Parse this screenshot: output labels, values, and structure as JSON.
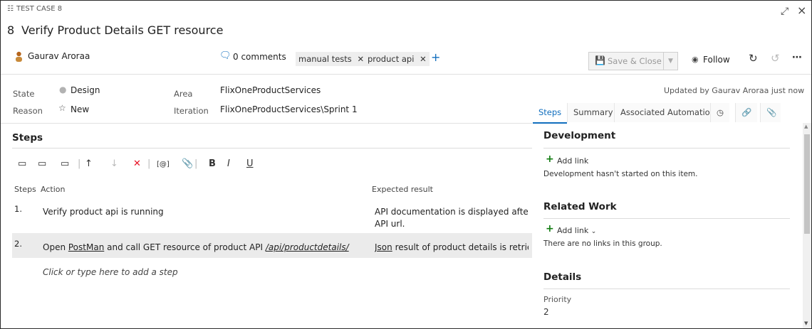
{
  "header": {
    "work_item_type": "TEST CASE 8",
    "id": "8",
    "title": "Verify Product Details GET resource",
    "assigned_to": "Gaurav Aroraa",
    "comments": "0 comments",
    "tags": [
      "manual tests",
      "product api"
    ],
    "save_close_label": "Save & Close",
    "follow_label": "Follow",
    "updated_text": "Updated by Gaurav Aroraa just now"
  },
  "fields": {
    "state_label": "State",
    "state_value": "Design",
    "reason_label": "Reason",
    "reason_value": "New",
    "area_label": "Area",
    "area_value": "FlixOneProductServices",
    "iteration_label": "Iteration",
    "iteration_value": "FlixOneProductServices\\Sprint 1"
  },
  "steps": {
    "heading": "Steps",
    "col_steps": "Steps",
    "col_action": "Action",
    "col_expected": "Expected result",
    "rows": [
      {
        "num": "1.",
        "action": "Verify product api is running",
        "expected_line1": "API documentation is displayed after bro",
        "expected_line2": "API url."
      },
      {
        "num": "2.",
        "action_prefix": "Open ",
        "action_link": "PostMan",
        "action_mid": " and call GET resource of product API ",
        "action_path": "/api/productdetails/",
        "expected_link": "Json",
        "expected_rest": " result of product details is retrieved"
      }
    ],
    "add_step_placeholder": "Click or type here to add a step"
  },
  "toolbar": {
    "bold": "B",
    "italic": "I",
    "underline": "U",
    "param": "[@]"
  },
  "right_tabs": [
    "Steps",
    "Summary",
    "Associated Automation"
  ],
  "right_panel": {
    "development_title": "Development",
    "add_link": "Add link",
    "development_text": "Development hasn't started on this item.",
    "related_title": "Related Work",
    "add_link_dropdown": "Add link",
    "related_text": "There are no links in this group.",
    "details_title": "Details",
    "priority_label": "Priority",
    "priority_value": "2"
  },
  "colors": {
    "accent": "#106ebe",
    "green": "#107c10",
    "red": "#e81123",
    "row_selected": "#ebebeb"
  }
}
